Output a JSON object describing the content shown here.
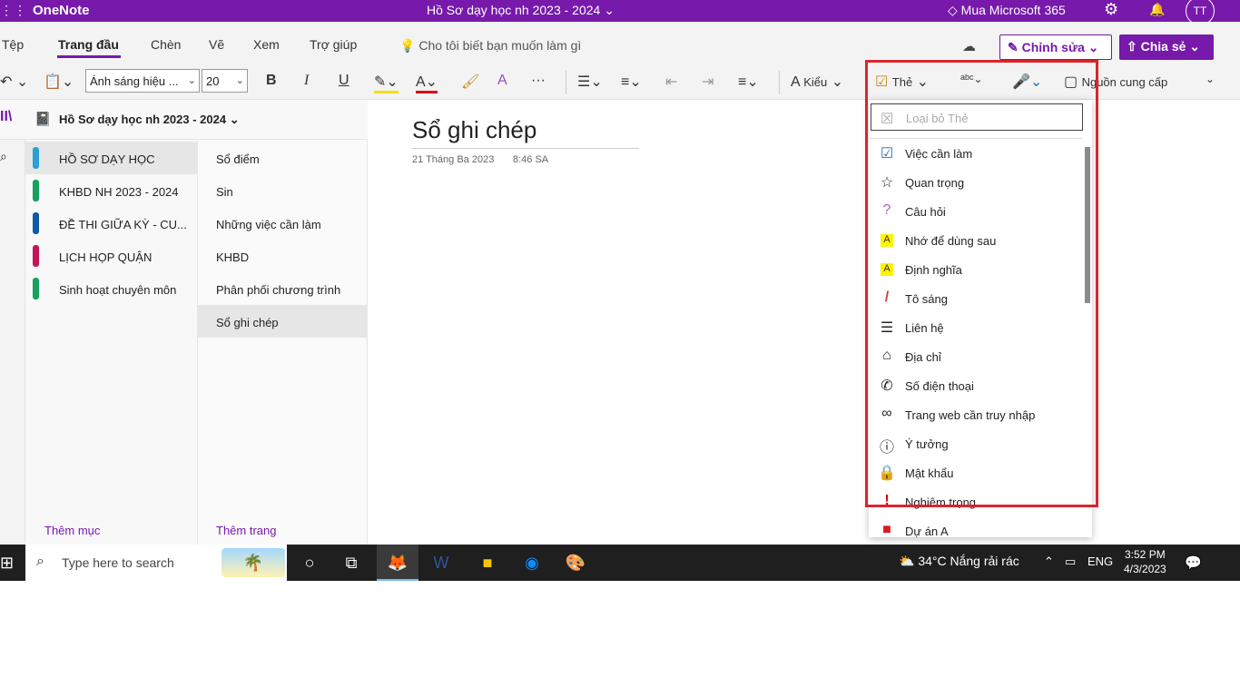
{
  "titlebar": {
    "app_name": "OneNote",
    "document_title": "Hồ Sơ dạy học nh 2023 - 2024 ⌄",
    "buy": "Mua Microsoft 365",
    "avatar": "TT"
  },
  "menu": {
    "tabs": [
      "Tệp",
      "Trang đầu",
      "Chèn",
      "Vẽ",
      "Xem",
      "Trợ giúp"
    ],
    "tell_me": "Cho tôi biết bạn muốn làm gì",
    "edit_button": "✎ Chỉnh sửa ⌄",
    "share_button": "⇧ Chia sẻ ⌄"
  },
  "toolbar": {
    "style_value": "Ánh sáng hiệu ...",
    "font_size": "20",
    "bold": "B",
    "italic": "I",
    "underline": "U",
    "more": "···",
    "styles_label": "Kiểu",
    "tag_label": "Thẻ",
    "spell_label": "abc",
    "sources_label": "Nguồn cung cấp"
  },
  "notebook": {
    "name": "Hồ Sơ dạy học nh 2023 - 2024",
    "add_section": "Thêm mục",
    "add_page": "Thêm trang",
    "sections": [
      {
        "label": "HỒ SƠ DẠY HỌC",
        "color": "#2aa0d8"
      },
      {
        "label": "KHBD NH 2023 - 2024",
        "color": "#16a05d"
      },
      {
        "label": "ĐỀ THI GIỮA KỲ - CU...",
        "color": "#0f5aa8"
      },
      {
        "label": "LỊCH HỌP QUẬN",
        "color": "#c3165a"
      },
      {
        "label": "Sinh hoạt chuyên môn",
        "color": "#16a05d"
      }
    ],
    "pages": [
      "Sổ điểm",
      "Sin",
      "Những việc cần làm",
      "KHBD",
      "Phân phối chương trình",
      "Sổ ghi chép"
    ]
  },
  "page": {
    "title": "Sổ ghi chép",
    "date": "21 Tháng Ba 2023",
    "time": "8:46 SA"
  },
  "tags_dropdown": {
    "remove_label": "Loại bỏ Thẻ",
    "items": [
      {
        "label": "Việc cần làm",
        "icon": "☑"
      },
      {
        "label": "Quan trọng",
        "icon": "☆"
      },
      {
        "label": "Câu hỏi",
        "icon": "?"
      },
      {
        "label": "Nhớ để dùng sau",
        "icon": "A"
      },
      {
        "label": "Định nghĩa",
        "icon": "A"
      },
      {
        "label": "Tô sáng",
        "icon": "/"
      },
      {
        "label": "Liên hệ",
        "icon": "☰"
      },
      {
        "label": "Địa chỉ",
        "icon": "⌂"
      },
      {
        "label": "Số điện thoại",
        "icon": "✆"
      },
      {
        "label": "Trang web cần truy nhập",
        "icon": "∞"
      },
      {
        "label": "Ý tưởng",
        "icon": "ⓘ"
      },
      {
        "label": "Mật khẩu",
        "icon": "🔒"
      },
      {
        "label": "Nghiêm trọng",
        "icon": "!"
      },
      {
        "label": "Dự án A",
        "icon": "■"
      }
    ]
  },
  "taskbar": {
    "search_placeholder": "Type here to search",
    "weather": "34°C  Nắng rải rác",
    "language": "ENG",
    "time": "3:52 PM",
    "date": "4/3/2023"
  }
}
